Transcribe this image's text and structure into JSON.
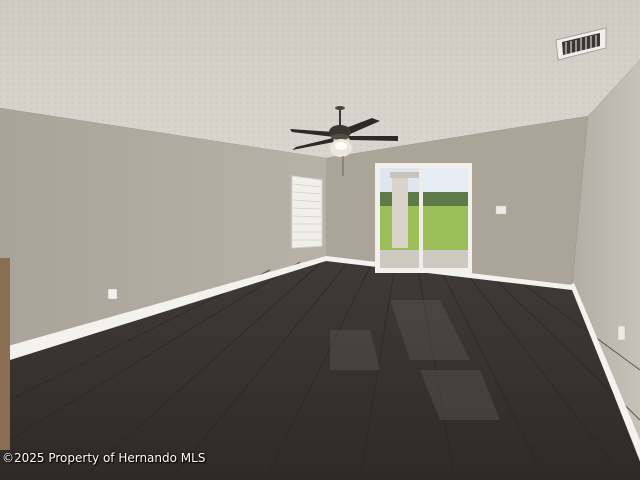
{
  "photo": {
    "subject": "empty-room-with-ceiling-fan-and-sliding-door",
    "watermark": "©2025 Property of Hernando MLS"
  },
  "colors": {
    "ceiling": "#d7d3cc",
    "left_wall": "#b2ada3",
    "back_wall": "#aba59b",
    "right_wall": "#bdb9b0",
    "floor": "#36322f",
    "baseboard": "#f2f1ee",
    "window_sky": "#dfe6f0",
    "grass": "#9cbf5a"
  },
  "icons": [
    "ceiling-fan-icon",
    "air-vent-icon",
    "outlet-icon"
  ]
}
